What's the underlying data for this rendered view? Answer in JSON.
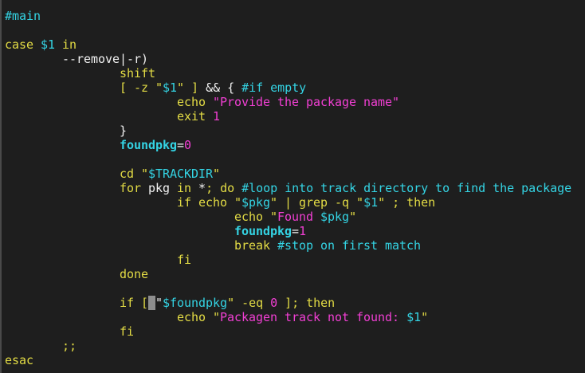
{
  "colors": {
    "yellow": "#e3dc45",
    "cyan": "#34d4e4",
    "magenta": "#f23fd4",
    "white": "#f2f2f2",
    "background": "#1e1e1e"
  },
  "lines": [
    [
      {
        "t": "#main",
        "c": "c"
      }
    ],
    [],
    [
      {
        "t": "case ",
        "c": "y"
      },
      {
        "t": "$1",
        "c": "c"
      },
      {
        "t": " in",
        "c": "y"
      }
    ],
    [
      {
        "t": "        --remove|-r)",
        "c": "w"
      }
    ],
    [
      {
        "t": "                shift",
        "c": "y"
      }
    ],
    [
      {
        "t": "                [ -z \"",
        "c": "y"
      },
      {
        "t": "$1",
        "c": "c"
      },
      {
        "t": "\" ] ",
        "c": "y"
      },
      {
        "t": "&& { ",
        "c": "w"
      },
      {
        "t": "#if empty",
        "c": "c"
      }
    ],
    [
      {
        "t": "                        echo ",
        "c": "y"
      },
      {
        "t": "\"Provide the package name\"",
        "c": "m"
      }
    ],
    [
      {
        "t": "                        exit ",
        "c": "y"
      },
      {
        "t": "1",
        "c": "m"
      }
    ],
    [
      {
        "t": "                }",
        "c": "w"
      }
    ],
    [
      {
        "t": "                ",
        "c": "w"
      },
      {
        "t": "foundpkg",
        "c": "c b"
      },
      {
        "t": "=",
        "c": "w"
      },
      {
        "t": "0",
        "c": "m"
      }
    ],
    [],
    [
      {
        "t": "                cd \"",
        "c": "y"
      },
      {
        "t": "$TRACKDIR",
        "c": "c"
      },
      {
        "t": "\"",
        "c": "y"
      }
    ],
    [
      {
        "t": "                for ",
        "c": "y"
      },
      {
        "t": "pkg",
        "c": "w"
      },
      {
        "t": " in ",
        "c": "y"
      },
      {
        "t": "*",
        "c": "w"
      },
      {
        "t": "; do ",
        "c": "y"
      },
      {
        "t": "#loop into track directory to find the package",
        "c": "c"
      }
    ],
    [
      {
        "t": "                        if echo \"",
        "c": "y"
      },
      {
        "t": "$pkg",
        "c": "c"
      },
      {
        "t": "\" | grep -q \"",
        "c": "y"
      },
      {
        "t": "$1",
        "c": "c"
      },
      {
        "t": "\" ; then",
        "c": "y"
      }
    ],
    [
      {
        "t": "                                echo \"",
        "c": "y"
      },
      {
        "t": "Found ",
        "c": "m"
      },
      {
        "t": "$pkg",
        "c": "c"
      },
      {
        "t": "\"",
        "c": "y"
      }
    ],
    [
      {
        "t": "                                ",
        "c": "w"
      },
      {
        "t": "foundpkg",
        "c": "c b"
      },
      {
        "t": "=",
        "c": "w"
      },
      {
        "t": "1",
        "c": "m"
      }
    ],
    [
      {
        "t": "                                break ",
        "c": "y"
      },
      {
        "t": "#stop on first match",
        "c": "c"
      }
    ],
    [
      {
        "t": "                        fi",
        "c": "y"
      }
    ],
    [
      {
        "t": "                done",
        "c": "y"
      }
    ],
    [],
    [
      {
        "t": "                if [",
        "c": "y"
      },
      {
        "t": " ",
        "c": "cursor"
      },
      {
        "t": "\"",
        "c": "w"
      },
      {
        "t": "$foundpkg",
        "c": "c"
      },
      {
        "t": "\" -eq ",
        "c": "y"
      },
      {
        "t": "0",
        "c": "m"
      },
      {
        "t": " ]; then",
        "c": "y"
      }
    ],
    [
      {
        "t": "                        echo \"",
        "c": "y"
      },
      {
        "t": "Packagen track not found: ",
        "c": "m"
      },
      {
        "t": "$1",
        "c": "c"
      },
      {
        "t": "\"",
        "c": "y"
      }
    ],
    [
      {
        "t": "                fi",
        "c": "y"
      }
    ],
    [
      {
        "t": "        ;;",
        "c": "y"
      }
    ],
    [
      {
        "t": "esac",
        "c": "y"
      }
    ]
  ]
}
